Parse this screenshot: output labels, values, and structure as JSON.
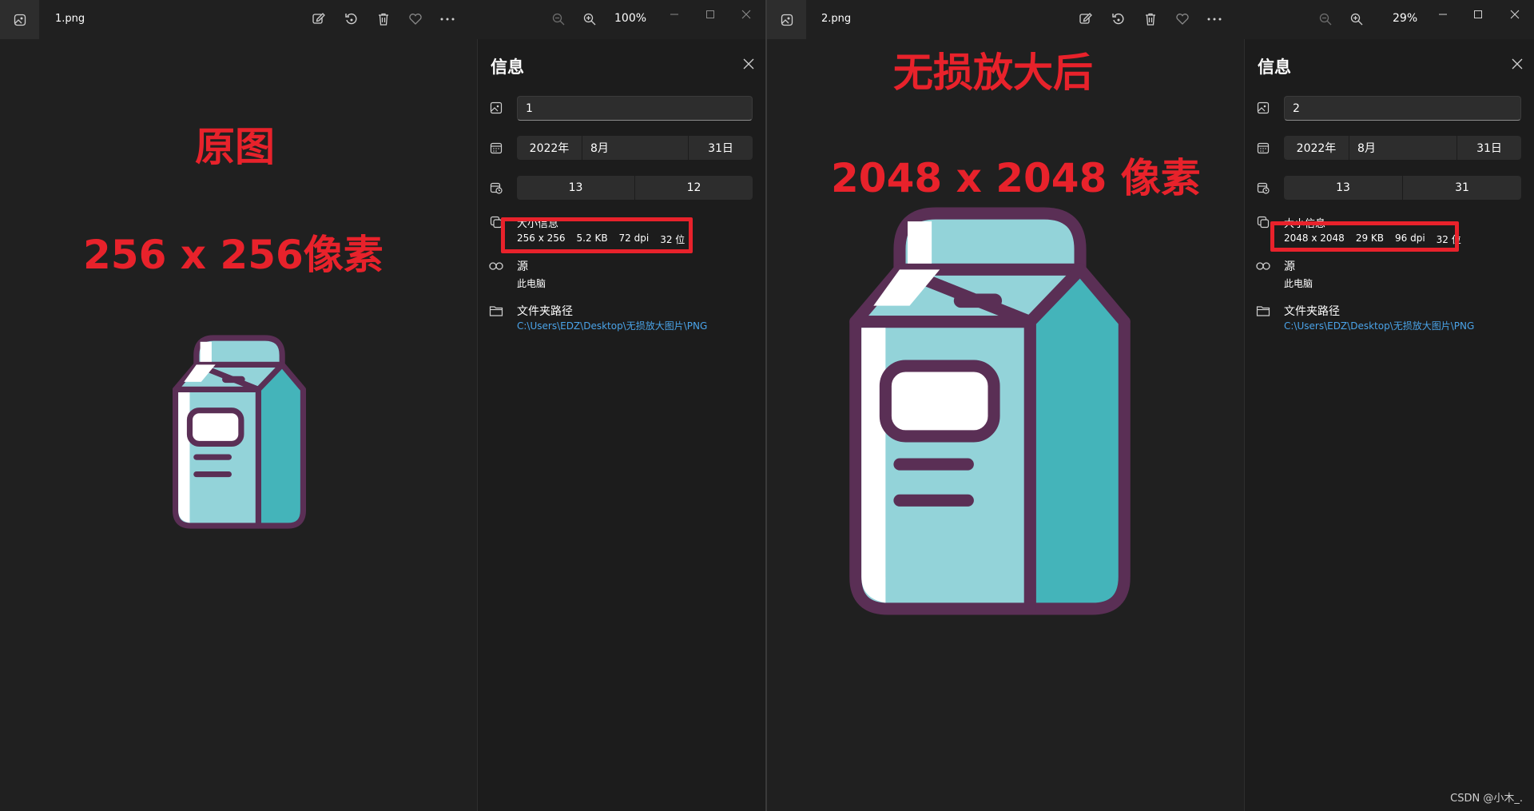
{
  "colors": {
    "annotation": "#e8222b",
    "link": "#4aa3e8",
    "carton_outline": "#5a2f55",
    "carton_light": "#93d3d9",
    "carton_dark": "#44b4ba"
  },
  "windows": [
    {
      "file_name": "1.png",
      "zoom": "100%",
      "annotations": [
        "原图",
        "256 x 256像素"
      ],
      "info": {
        "title": "信息",
        "name_value": "1",
        "date": [
          "2022年",
          "8月",
          "31日"
        ],
        "time": [
          "13",
          "12"
        ],
        "size_label": "大小信息",
        "size_meta": [
          "256 x 256",
          "5.2 KB",
          "72 dpi",
          "32 位"
        ],
        "source_label": "源",
        "source_value": "此电脑",
        "folder_label": "文件夹路径",
        "folder_path": "C:\\Users\\EDZ\\Desktop\\无损放大图片\\PNG"
      }
    },
    {
      "file_name": "2.png",
      "zoom": "29%",
      "annotations": [
        "无损放大后",
        "2048 x 2048 像素"
      ],
      "info": {
        "title": "信息",
        "name_value": "2",
        "date": [
          "2022年",
          "8月",
          "31日"
        ],
        "time": [
          "13",
          "31"
        ],
        "size_label": "大小信息",
        "size_meta": [
          "2048 x 2048",
          "29 KB",
          "96 dpi",
          "32 位"
        ],
        "source_label": "源",
        "source_value": "此电脑",
        "folder_label": "文件夹路径",
        "folder_path": "C:\\Users\\EDZ\\Desktop\\无损放大图片\\PNG"
      }
    }
  ],
  "watermark": "CSDN @小木_."
}
